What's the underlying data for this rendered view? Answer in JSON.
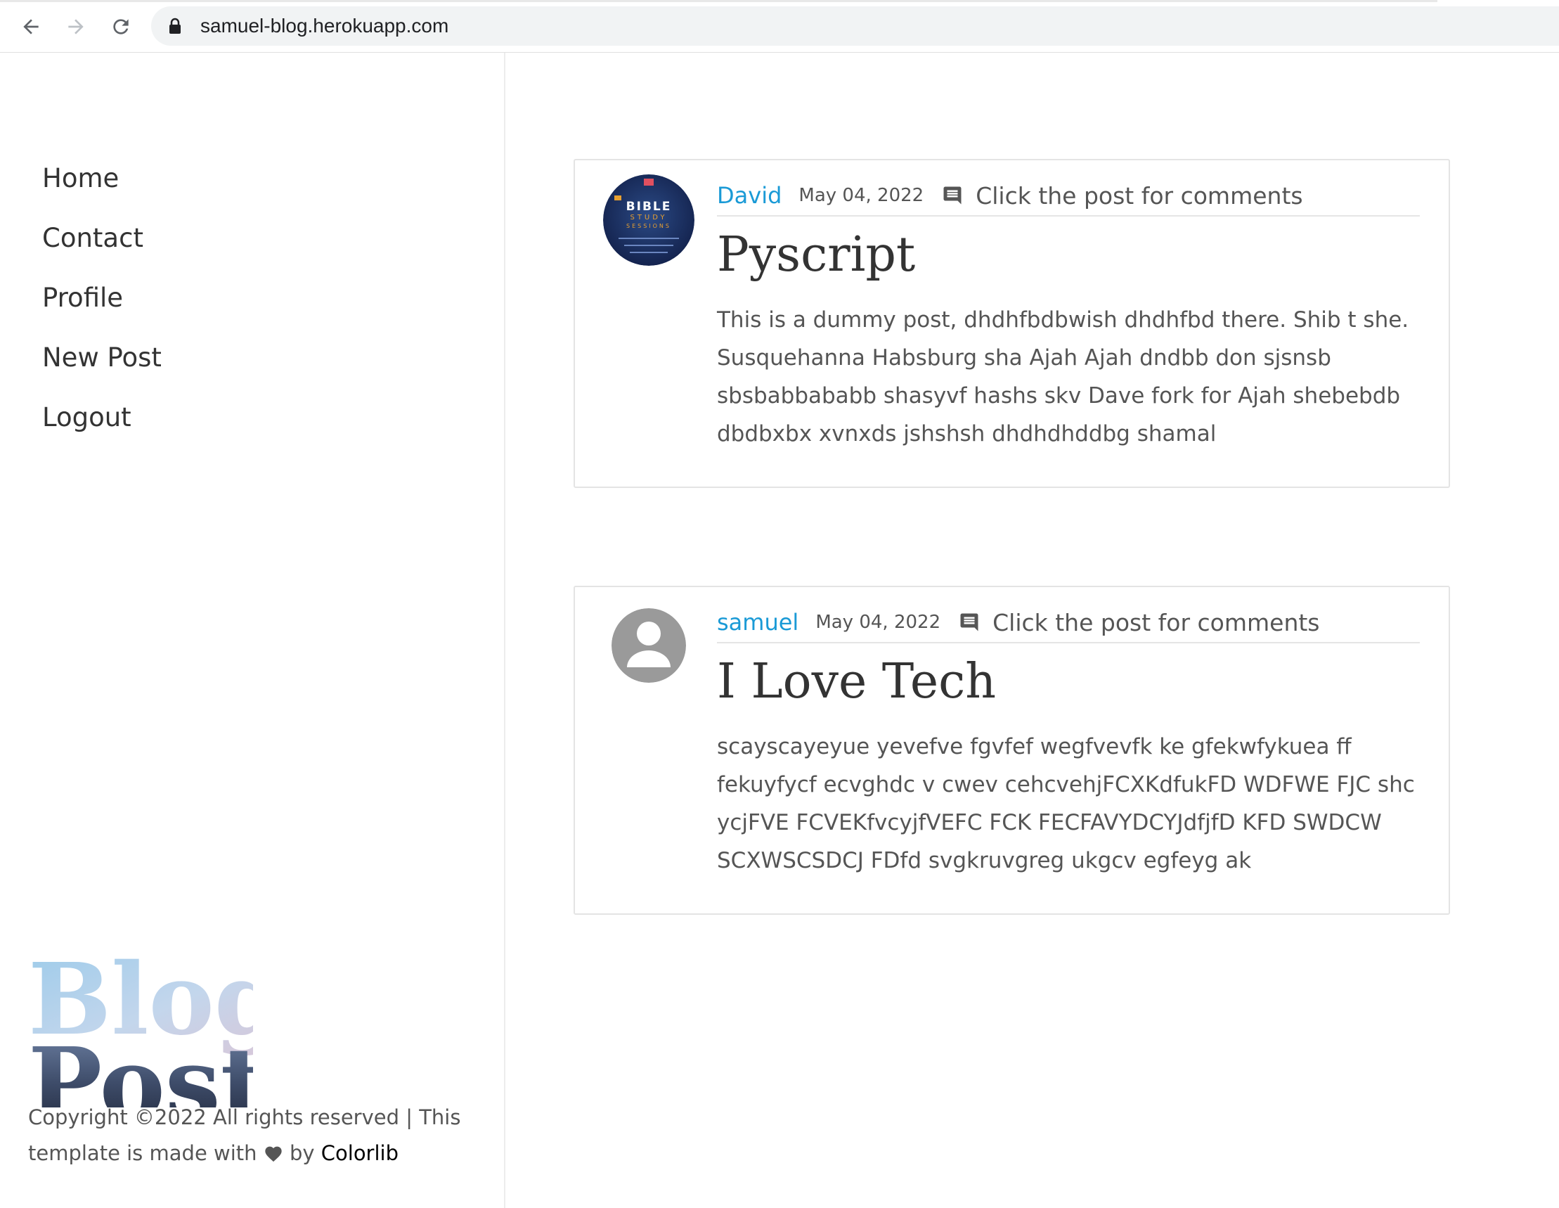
{
  "browser": {
    "url": "samuel-blog.herokuapp.com"
  },
  "sidebar": {
    "nav_items": [
      {
        "label": "Home"
      },
      {
        "label": "Contact"
      },
      {
        "label": "Profile"
      },
      {
        "label": "New Post"
      },
      {
        "label": "Logout"
      }
    ],
    "logo_text": [
      "Blog",
      "Post"
    ],
    "copyright_prefix": "Copyright ©2022 All rights reserved | This template is made with",
    "copyright_by": "by",
    "copyright_link": "Colorlib"
  },
  "posts": [
    {
      "author": "David",
      "date": "May 04, 2022",
      "comment_label": "Click the post for comments",
      "title": "Pyscript",
      "body": "This is a dummy post, dhdhfbdbwish dhdhfbd there. Shib t she. Susquehanna Habsburg sha Ajah Ajah dndbb don sjsnsb sbsbabbababb shasyvf hashs skv Dave fork for Ajah shebebdb dbdbxbx xvnxds jshshsh dhdhdhddbg shamal",
      "avatar_text": "BIBLE STUDY SESSIONS"
    },
    {
      "author": "samuel",
      "date": "May 04, 2022",
      "comment_label": "Click the post for comments",
      "title": "I Love Tech",
      "body": "scayscayeyue yevefve fgvfef wegfvevfk ke gfekwfykuea ff fekuyfycf ecvghdc v cwev cehcvehjFCXKdfukFD WDFWE FJC shc ycjFVE FCVEKfvcyjfVEFC FCK FECFAVYDCYJdfjfD KFD SWDCW SCXWSCSDCJ FDfd svgkruvgreg ukgcv egfeyg ak"
    }
  ],
  "colors": {
    "author_link": "#1a9ad6",
    "text": "#555555",
    "heading": "#333333"
  }
}
